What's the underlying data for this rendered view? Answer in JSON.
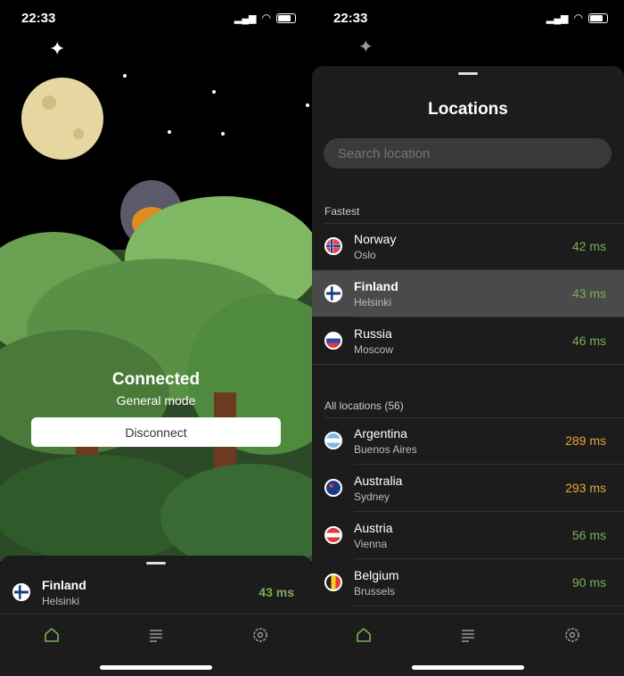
{
  "status": {
    "time": "22:33"
  },
  "home": {
    "status": "Connected",
    "mode": "General mode",
    "disconnect": "Disconnect",
    "current": {
      "country": "Finland",
      "city": "Helsinki",
      "ping": "43 ms",
      "flag": "finland"
    }
  },
  "locations": {
    "title": "Locations",
    "search_placeholder": "Search location",
    "fastest_label": "Fastest",
    "fastest": [
      {
        "country": "Norway",
        "city": "Oslo",
        "ping": "42 ms",
        "flag": "norway"
      },
      {
        "country": "Finland",
        "city": "Helsinki",
        "ping": "43 ms",
        "flag": "finland",
        "selected": true
      },
      {
        "country": "Russia",
        "city": "Moscow",
        "ping": "46 ms",
        "flag": "russia"
      }
    ],
    "all_label": "All locations (56)",
    "all": [
      {
        "country": "Argentina",
        "city": "Buenos Aires",
        "ping": "289 ms",
        "flag": "argentina"
      },
      {
        "country": "Australia",
        "city": "Sydney",
        "ping": "293 ms",
        "flag": "australia"
      },
      {
        "country": "Austria",
        "city": "Vienna",
        "ping": "56 ms",
        "flag": "austria"
      },
      {
        "country": "Belgium",
        "city": "Brussels",
        "ping": "90 ms",
        "flag": "belgium"
      }
    ]
  },
  "tabs": [
    "home-icon",
    "list-icon",
    "gear-icon"
  ],
  "colors": {
    "good": "#7cae57",
    "slow": "#e8a33a",
    "active_tab": "#7cae57",
    "background": "#1c1c1c",
    "selected_row": "#4a4a4a"
  }
}
